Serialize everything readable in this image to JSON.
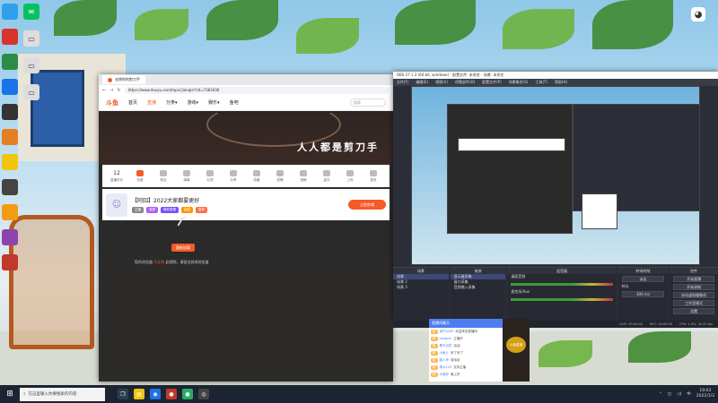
{
  "desktop": {
    "icon_labels": [
      "WeChat",
      "WinAll…",
      "",
      "",
      "",
      "",
      "",
      "",
      "",
      "",
      "",
      ""
    ],
    "corner_icon": "cat-icon"
  },
  "browser": {
    "tab_title": "去除你的剪刀手",
    "url": "https://www.douyu.com/topic/jianqie?rid=7383436",
    "nav": {
      "logo": "斗鱼",
      "items": [
        "首页",
        "直播",
        "分类▾",
        "游戏▾",
        "娱乐▾",
        "鱼吧"
      ],
      "active_index": 1,
      "search_placeholder": "搜索"
    },
    "hero_slogan": "人人都是剪刀手",
    "stats": [
      {
        "num": "12",
        "label": "直播时长"
      },
      {
        "num": "",
        "label": "热度"
      },
      {
        "num": "",
        "label": "粉丝"
      },
      {
        "num": "",
        "label": "弹幕"
      },
      {
        "num": "",
        "label": "礼物"
      },
      {
        "num": "",
        "label": "分享"
      },
      {
        "num": "",
        "label": "收藏"
      },
      {
        "num": "",
        "label": "剪辑"
      },
      {
        "num": "",
        "label": "投稿"
      },
      {
        "num": "",
        "label": "高光"
      },
      {
        "num": "",
        "label": "上传"
      },
      {
        "num": "",
        "label": "更多"
      }
    ],
    "clip": {
      "title": "【阿囧】2022大家都要更好",
      "tags": [
        "主播",
        "竖屏",
        "精彩剪辑",
        "高能",
        "推荐"
      ],
      "button": "立即剪辑"
    },
    "player_button": "重新加载",
    "player_note_prefix": "您的浏览器 ",
    "player_note_highlight": "不支持",
    "player_note_suffix": " 此视频，请尝试其他浏览器"
  },
  "obs": {
    "title": "OBS 27.1.3 (64 bit, windows) - 配置文件: 未命名 - 场景: 未命名",
    "menu": [
      "文件(F)",
      "编辑(E)",
      "视图(V)",
      "停靠部件(D)",
      "配置文件(P)",
      "场景集合(S)",
      "工具(T)",
      "帮助(H)"
    ],
    "docks": {
      "scenes_title": "场景",
      "scenes": [
        "场景",
        "场景 2",
        "场景 3"
      ],
      "sources_title": "来源",
      "sources": [
        "显示器采集",
        "窗口采集",
        "音频输入采集"
      ],
      "mixer_title": "混音器",
      "mixer_labels": [
        "桌面音频",
        "麦克风/Aux"
      ],
      "transitions_title": "转场特效",
      "transition_value": "淡出",
      "duration_label": "时长",
      "duration_value": "300 ms",
      "controls_title": "控件",
      "controls": [
        "开始直播",
        "开始录制",
        "启动虚拟摄像机",
        "工作室模式",
        "设置",
        "退出"
      ]
    },
    "status": [
      "LIVE: 00:00:00",
      "REC: 00:00:00",
      "CPU: 1.9%, 30.00 fps"
    ]
  },
  "chat": {
    "header": "直播间聊天",
    "lines": [
      {
        "badge": "粉",
        "user": "用户8283",
        "text": "欢迎来到直播间"
      },
      {
        "badge": "粉",
        "user": "jiangxin",
        "text": "主播好"
      },
      {
        "badge": "粉",
        "user": "看不见的",
        "text": "加油"
      },
      {
        "badge": "粉",
        "user": "小鱼儿",
        "text": "来了来了"
      },
      {
        "badge": "粉",
        "user": "路人甲",
        "text": "哈哈哈"
      },
      {
        "badge": "粉",
        "user": "观众123",
        "text": "支持主播"
      },
      {
        "badge": "粉",
        "user": "大家好",
        "text": "晚上好"
      }
    ],
    "live_badge": "斗鱼直播"
  },
  "taskbar": {
    "search_placeholder": "在这里输入你要搜索的内容",
    "time": "19:03",
    "date": "2022/1/3",
    "lang": "中"
  },
  "colors": {
    "accent": "#f45b27",
    "obs_bg": "#2b2e38",
    "taskbar": "#1c2433"
  }
}
